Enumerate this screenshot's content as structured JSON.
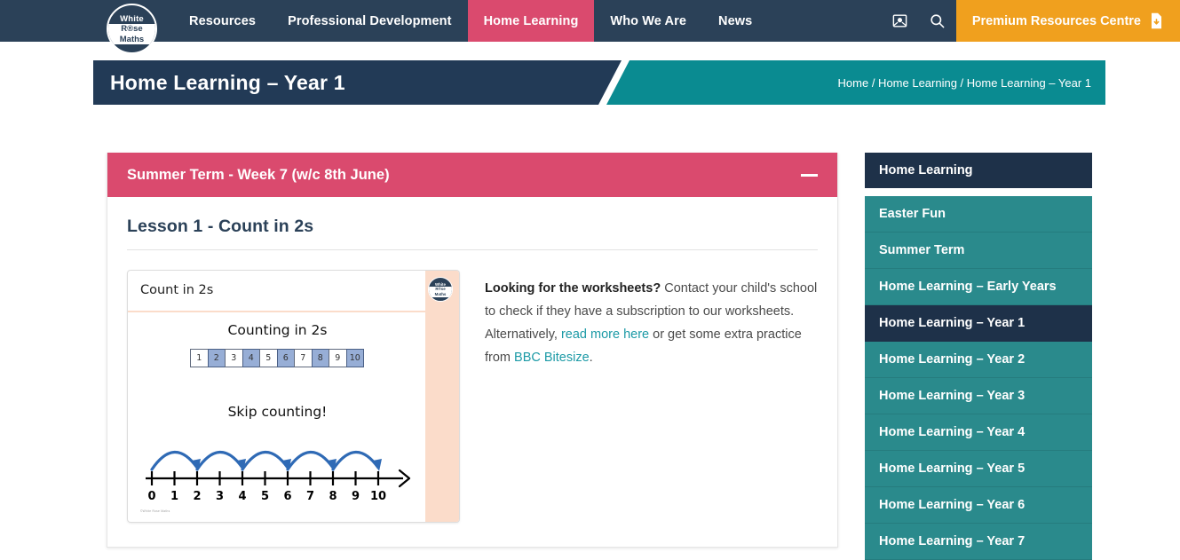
{
  "nav": {
    "logo": {
      "line1": "White",
      "line2": "R®se",
      "line3": "Maths",
      "name": "white-rose-maths-logo"
    },
    "items": [
      {
        "label": "Resources",
        "active": false
      },
      {
        "label": "Professional Development",
        "active": false
      },
      {
        "label": "Home Learning",
        "active": true
      },
      {
        "label": "Who We Are",
        "active": false
      },
      {
        "label": "News",
        "active": false
      }
    ],
    "mail_icon": "mail-icon",
    "search_icon": "search-icon",
    "premium_label": "Premium Resources Centre",
    "premium_icon": "document-download-icon",
    "colors": {
      "bar": "#2b4158",
      "active": "#da4a6e",
      "premium": "#f0a01e"
    }
  },
  "banner": {
    "title": "Home Learning – Year 1",
    "breadcrumb": "Home / Home Learning / Home Learning – Year 1",
    "colors": {
      "navy": "#223a56",
      "teal": "#0a8b91"
    }
  },
  "accordion": {
    "header": "Summer Term - Week 7 (w/c 8th June)",
    "collapse_icon": "minus-icon",
    "color": "#da4a6e"
  },
  "lesson": {
    "title": "Lesson 1 - Count in 2s",
    "text_bold": "Looking for the worksheets?",
    "text_1": " Contact your child's school to check if they have a subscription to our worksheets. Alternatively, ",
    "link_1": "read more here",
    "text_2": " or get some extra practice from ",
    "link_2": "BBC Bitesize",
    "text_3": ".",
    "link_color": "#1c9aa6"
  },
  "slide": {
    "title": "Count in 2s",
    "heading_1": "Counting in 2s",
    "heading_2": "Skip counting!",
    "numbers": [
      "1",
      "2",
      "3",
      "4",
      "5",
      "6",
      "7",
      "8",
      "9",
      "10"
    ],
    "highlighted": [
      2,
      4,
      6,
      8,
      10
    ],
    "numberline_labels": [
      "0",
      "1",
      "2",
      "3",
      "4",
      "5",
      "6",
      "7",
      "8",
      "9",
      "10"
    ],
    "jumps": [
      [
        0,
        2
      ],
      [
        2,
        4
      ],
      [
        4,
        6
      ],
      [
        6,
        8
      ],
      [
        8,
        10
      ]
    ],
    "watermark": "©White Rose Maths",
    "stripe_color": "#fbdcca",
    "highlight_color": "#97aed6",
    "arc_color": "#2f6ab5"
  },
  "sidebar": {
    "heading": "Home Learning",
    "items": [
      {
        "label": "Easter Fun",
        "active": false
      },
      {
        "label": "Summer Term",
        "active": false
      },
      {
        "label": "Home Learning – Early Years",
        "active": false
      },
      {
        "label": "Home Learning – Year 1",
        "active": true
      },
      {
        "label": "Home Learning – Year 2",
        "active": false
      },
      {
        "label": "Home Learning – Year 3",
        "active": false
      },
      {
        "label": "Home Learning – Year 4",
        "active": false
      },
      {
        "label": "Home Learning – Year 5",
        "active": false
      },
      {
        "label": "Home Learning – Year 6",
        "active": false
      },
      {
        "label": "Home Learning – Year 7",
        "active": false
      }
    ],
    "colors": {
      "item": "#2a8a8c",
      "active": "#1e3149"
    }
  }
}
